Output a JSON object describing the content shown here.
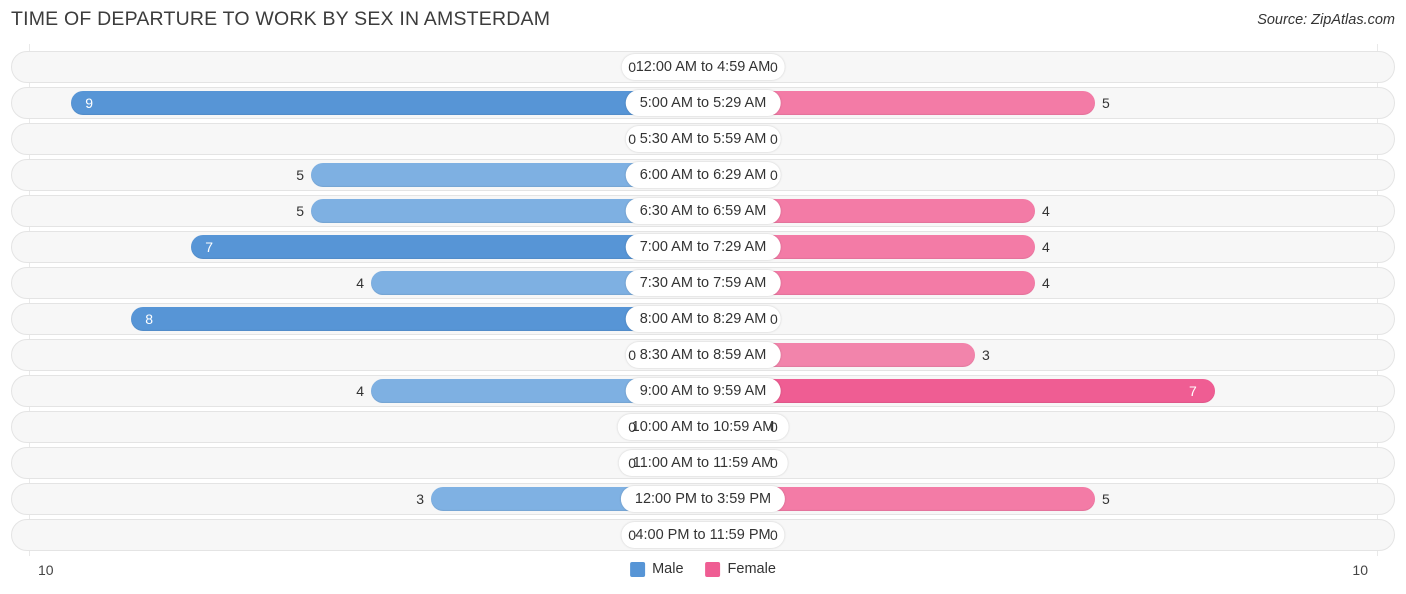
{
  "header": {
    "title": "TIME OF DEPARTURE TO WORK BY SEX IN AMSTERDAM",
    "source": "Source: ZipAtlas.com"
  },
  "legend": {
    "items": [
      {
        "label": "Male",
        "color": "#5795d6"
      },
      {
        "label": "Female",
        "color": "#ef5d93"
      }
    ]
  },
  "axis": {
    "left_max": "10",
    "right_max": "10"
  },
  "chart_data": {
    "type": "bar",
    "subtype": "diverging-bidirectional",
    "title": "TIME OF DEPARTURE TO WORK BY SEX IN AMSTERDAM",
    "xlabel": "",
    "ylabel": "",
    "xlim": [
      0,
      10
    ],
    "grid": false,
    "legend_position": "bottom-center",
    "categories": [
      "12:00 AM to 4:59 AM",
      "5:00 AM to 5:29 AM",
      "5:30 AM to 5:59 AM",
      "6:00 AM to 6:29 AM",
      "6:30 AM to 6:59 AM",
      "7:00 AM to 7:29 AM",
      "7:30 AM to 7:59 AM",
      "8:00 AM to 8:29 AM",
      "8:30 AM to 8:59 AM",
      "9:00 AM to 9:59 AM",
      "10:00 AM to 10:59 AM",
      "11:00 AM to 11:59 AM",
      "12:00 PM to 3:59 PM",
      "4:00 PM to 11:59 PM"
    ],
    "series": [
      {
        "name": "Male",
        "direction": "left",
        "color": "#5795d6",
        "values": [
          0,
          9,
          0,
          5,
          5,
          7,
          4,
          8,
          0,
          4,
          0,
          0,
          3,
          0
        ]
      },
      {
        "name": "Female",
        "direction": "right",
        "color": "#ef5d93",
        "values": [
          0,
          5,
          0,
          0,
          4,
          4,
          4,
          0,
          3,
          7,
          0,
          0,
          5,
          0
        ]
      }
    ]
  },
  "rows": [
    {
      "label": "12:00 AM to 4:59 AM",
      "male": "0",
      "female": "0"
    },
    {
      "label": "5:00 AM to 5:29 AM",
      "male": "9",
      "female": "5"
    },
    {
      "label": "5:30 AM to 5:59 AM",
      "male": "0",
      "female": "0"
    },
    {
      "label": "6:00 AM to 6:29 AM",
      "male": "5",
      "female": "0"
    },
    {
      "label": "6:30 AM to 6:59 AM",
      "male": "5",
      "female": "4"
    },
    {
      "label": "7:00 AM to 7:29 AM",
      "male": "7",
      "female": "4"
    },
    {
      "label": "7:30 AM to 7:59 AM",
      "male": "4",
      "female": "4"
    },
    {
      "label": "8:00 AM to 8:29 AM",
      "male": "8",
      "female": "0"
    },
    {
      "label": "8:30 AM to 8:59 AM",
      "male": "0",
      "female": "3"
    },
    {
      "label": "9:00 AM to 9:59 AM",
      "male": "4",
      "female": "7"
    },
    {
      "label": "10:00 AM to 10:59 AM",
      "male": "0",
      "female": "0"
    },
    {
      "label": "11:00 AM to 11:59 AM",
      "male": "0",
      "female": "0"
    },
    {
      "label": "12:00 PM to 3:59 PM",
      "male": "3",
      "female": "5"
    },
    {
      "label": "4:00 PM to 11:59 PM",
      "male": "0",
      "female": "0"
    }
  ]
}
